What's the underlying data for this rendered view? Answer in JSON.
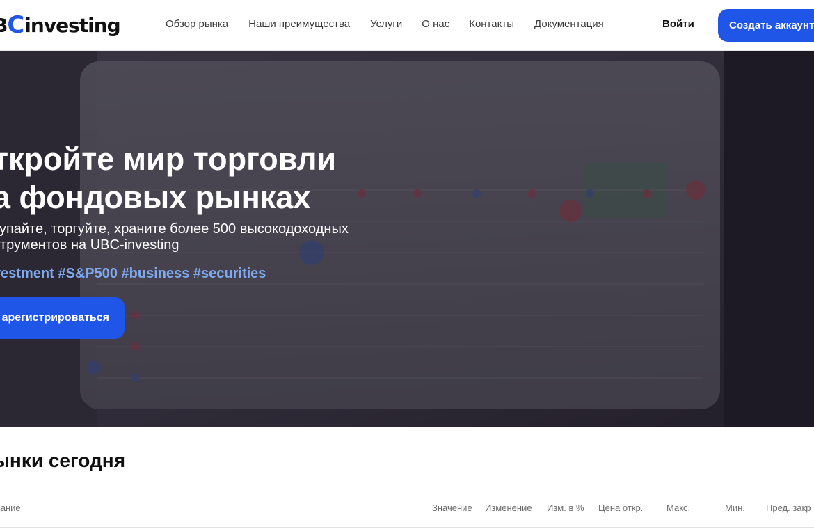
{
  "header": {
    "logo_prefix": "B",
    "logo_c": "C",
    "logo_text": "investing",
    "nav": [
      "Обзор рынка",
      "Наши преимущества",
      "Услуги",
      "О нас",
      "Контакты",
      "Документация"
    ],
    "login_label": "Войти",
    "signup_label": "Создать аккаунт"
  },
  "hero": {
    "title": "ткройте мир торговли\nа фондовых рынках",
    "subtitle": "купайте, торгуйте, храните более 500 высокодоходных\nструментов на UBC-investing",
    "tags": "vestment #S&P500 #business #securities",
    "cta_label": "арегистрироваться"
  },
  "markets": {
    "title": "ынки сегодня",
    "columns": [
      "вание",
      "Значение",
      "Изменение",
      "Изм. в %",
      "Цена откр.",
      "Макс.",
      "Мин.",
      "Пред. закр"
    ]
  },
  "colors": {
    "accent": "#1f56e8",
    "tag_color": "#7ea9ee"
  }
}
